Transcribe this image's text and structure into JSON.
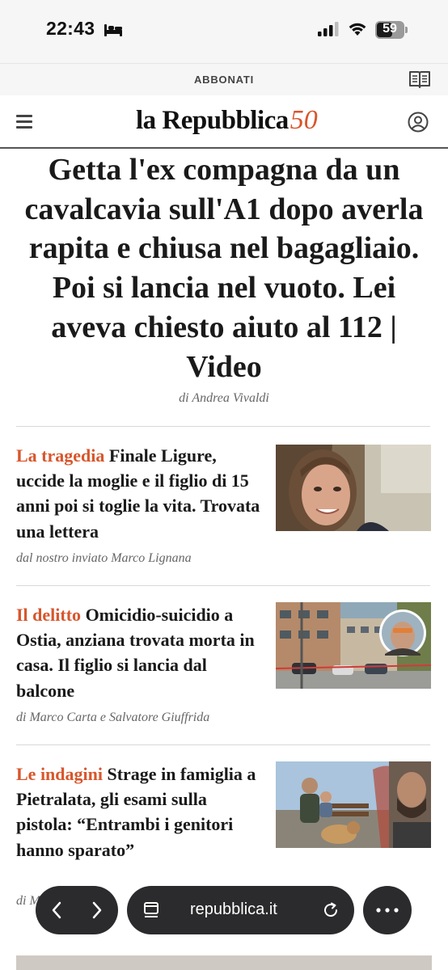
{
  "status_bar": {
    "time": "22:43",
    "battery_percent": "59",
    "battery_level": 0.59,
    "icons": [
      "bed-icon",
      "signal-icon",
      "wifi-icon",
      "battery-icon"
    ]
  },
  "subscribe_bar": {
    "label": "ABBONATI",
    "icon": "reader-icon"
  },
  "header": {
    "logo_text": "la Repubblica",
    "logo_anniversary": "50",
    "icons": [
      "menu-icon",
      "user-icon"
    ]
  },
  "main_article": {
    "headline": "Getta l'ex compagna da un cavalcavia sull'A1 dopo averla rapita e chiusa nel bagagliaio. Poi si lancia nel vuoto. Lei aveva chiesto aiuto al 112 | Video",
    "byline": "di Andrea Vivaldi"
  },
  "articles": [
    {
      "kicker": "La tragedia",
      "title": "Finale Ligure, uccide la moglie e il figlio di 15 anni poi si toglie la vita. Trovata una lettera",
      "byline": "dal nostro inviato Marco Lignana"
    },
    {
      "kicker": "Il delitto",
      "title": "Omicidio-suicidio a Ostia, anziana trovata morta in casa. Il figlio si lancia dal balcone",
      "byline": "di Marco Carta e Salvatore Giuffrida"
    },
    {
      "kicker": "Le indagini",
      "title": "Strage in famiglia a Pietralata, gli esami sulla pistola: “Entrambi i genitori hanno sparato”",
      "byline": "di Marco Carta"
    }
  ],
  "browser_bar": {
    "url": "repubblica.it",
    "icons": [
      "back-icon",
      "forward-icon",
      "tabs-icon",
      "reload-icon",
      "more-icon"
    ]
  },
  "colors": {
    "accent": "#d8562c",
    "text": "#1a1a1a",
    "byline": "#666666",
    "toolbar": "#2b2b2d"
  }
}
